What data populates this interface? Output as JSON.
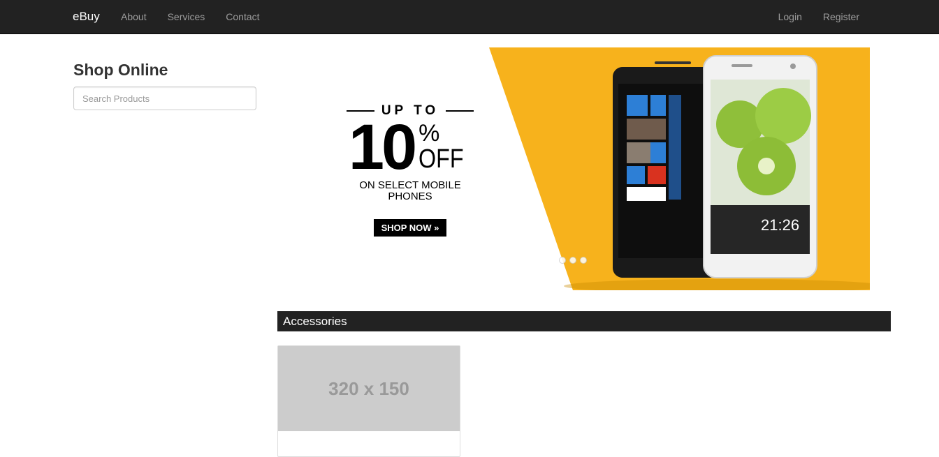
{
  "nav": {
    "brand": "eBuy",
    "links": [
      "About",
      "Services",
      "Contact"
    ],
    "right": [
      "Login",
      "Register"
    ]
  },
  "sidebar": {
    "title": "Shop Online",
    "search_placeholder": "Search Products"
  },
  "carousel": {
    "promo_up_to": "UP TO",
    "promo_number": "10",
    "promo_percent": "%",
    "promo_off": "OFF",
    "promo_sub": "ON SELECT MOBILE PHONES",
    "shop_now": "SHOP NOW »",
    "slide_count": 3,
    "active_slide": 1,
    "phone_time": "21:26",
    "colors": {
      "yellow": "#f7b21c"
    }
  },
  "section": {
    "title": "Accessories"
  },
  "product": {
    "image_label": "320 x 150"
  },
  "colors": {
    "navbar": "#222222",
    "nav_text": "#9d9d9d"
  }
}
